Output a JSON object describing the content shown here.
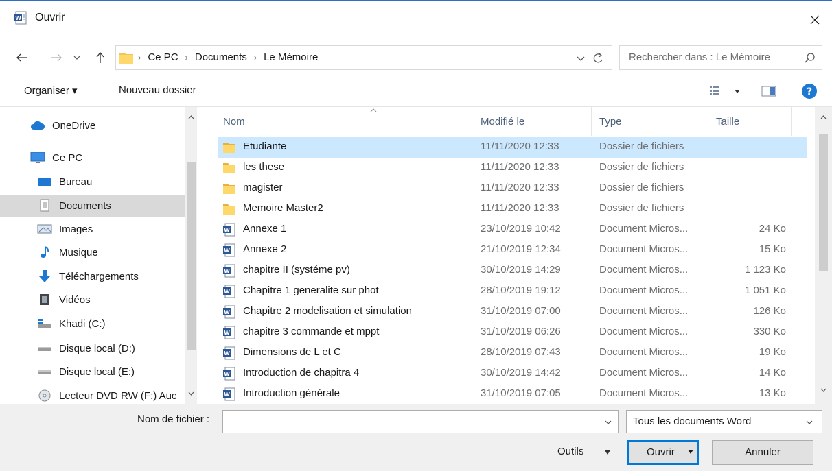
{
  "window": {
    "title": "Ouvrir",
    "title_icon": "word-doc-icon",
    "close_icon": "close-icon"
  },
  "address": {
    "crumbs": [
      "Ce PC",
      "Documents",
      "Le Mémoire"
    ],
    "search_placeholder": "Rechercher dans : Le Mémoire"
  },
  "toolbar": {
    "organize_label": "Organiser ▾",
    "new_folder_label": "Nouveau dossier"
  },
  "navpane": {
    "items": [
      {
        "label": "OneDrive",
        "icon": "cloud-icon"
      },
      {
        "label": "Ce PC",
        "icon": "computer-icon"
      },
      {
        "label": "Bureau",
        "icon": "desktop-icon"
      },
      {
        "label": "Documents",
        "icon": "documents-icon",
        "selected": true
      },
      {
        "label": "Images",
        "icon": "images-icon"
      },
      {
        "label": "Musique",
        "icon": "music-icon"
      },
      {
        "label": "Téléchargements",
        "icon": "download-icon"
      },
      {
        "label": "Vidéos",
        "icon": "video-icon"
      },
      {
        "label": "Khadi (C:)",
        "icon": "system-drive-icon"
      },
      {
        "label": "Disque local (D:)",
        "icon": "drive-icon"
      },
      {
        "label": "Disque local (E:)",
        "icon": "drive-icon"
      },
      {
        "label": "Lecteur DVD RW (F:) Auc",
        "icon": "dvd-icon"
      }
    ]
  },
  "files": {
    "columns": {
      "name": "Nom",
      "modified": "Modifié le",
      "type": "Type",
      "size": "Taille"
    },
    "rows": [
      {
        "name": "Etudiante",
        "modified": "11/11/2020 12:33",
        "type": "Dossier de fichiers",
        "size": "",
        "kind": "folder",
        "selected": true
      },
      {
        "name": "les these",
        "modified": "11/11/2020 12:33",
        "type": "Dossier de fichiers",
        "size": "",
        "kind": "folder"
      },
      {
        "name": "magister",
        "modified": "11/11/2020 12:33",
        "type": "Dossier de fichiers",
        "size": "",
        "kind": "folder"
      },
      {
        "name": "Memoire Master2",
        "modified": "11/11/2020 12:33",
        "type": "Dossier de fichiers",
        "size": "",
        "kind": "folder"
      },
      {
        "name": "Annexe 1",
        "modified": "23/10/2019 10:42",
        "type": "Document Micros...",
        "size": "24 Ko",
        "kind": "doc"
      },
      {
        "name": "Annexe 2",
        "modified": "21/10/2019 12:34",
        "type": "Document Micros...",
        "size": "15 Ko",
        "kind": "doc"
      },
      {
        "name": "chapitre  II (systéme pv)",
        "modified": "30/10/2019 14:29",
        "type": "Document Micros...",
        "size": "1 123 Ko",
        "kind": "doc"
      },
      {
        "name": "Chapitre 1 generalite sur phot",
        "modified": "28/10/2019 19:12",
        "type": "Document Micros...",
        "size": "1 051 Ko",
        "kind": "doc"
      },
      {
        "name": "Chapitre 2 modelisation et simulation",
        "modified": "31/10/2019 07:00",
        "type": "Document Micros...",
        "size": "126 Ko",
        "kind": "doc"
      },
      {
        "name": "chapitre 3 commande et mppt",
        "modified": "31/10/2019 06:26",
        "type": "Document Micros...",
        "size": "330 Ko",
        "kind": "doc"
      },
      {
        "name": "Dimensions de L et C",
        "modified": "28/10/2019 07:43",
        "type": "Document Micros...",
        "size": "19 Ko",
        "kind": "doc"
      },
      {
        "name": "Introduction de chapitra 4",
        "modified": "30/10/2019 14:42",
        "type": "Document Micros...",
        "size": "14 Ko",
        "kind": "doc"
      },
      {
        "name": "Introduction générale",
        "modified": "31/10/2019 07:05",
        "type": "Document Micros...",
        "size": "13 Ko",
        "kind": "doc"
      }
    ]
  },
  "bottom": {
    "filename_label": "Nom de fichier :",
    "filename_value": "",
    "filter_value": "Tous les documents Word",
    "tools_label": "Outils",
    "open_label": "Ouvrir",
    "cancel_label": "Annuler"
  },
  "colors": {
    "accent": "#0078d7",
    "selection": "#cce8ff",
    "nav_selection": "#d9d9d9",
    "header_text": "#4c607a"
  }
}
